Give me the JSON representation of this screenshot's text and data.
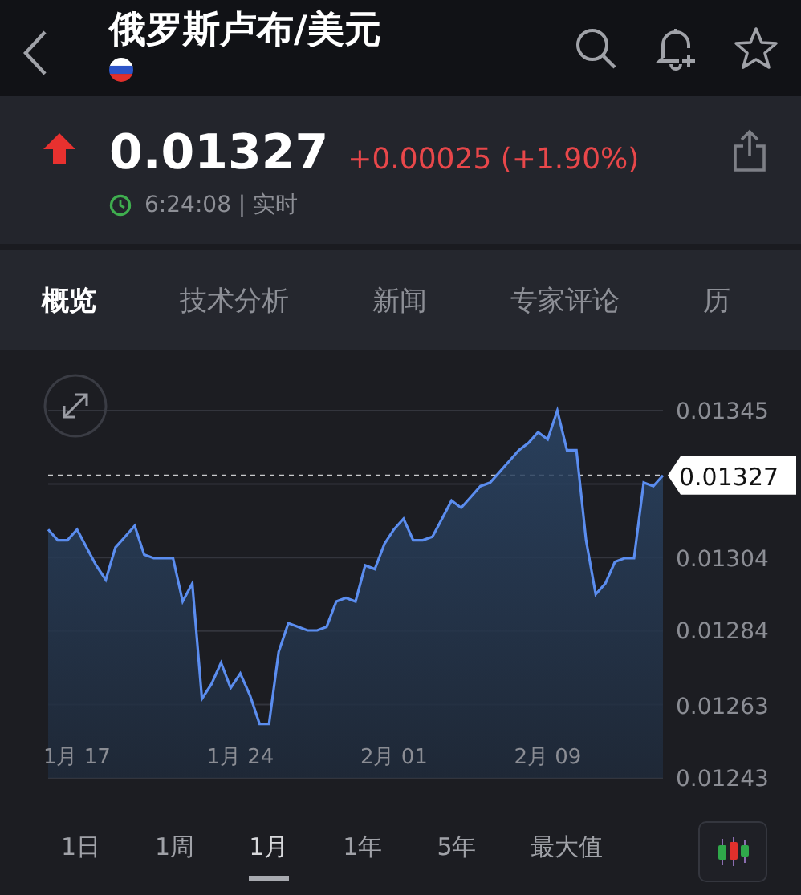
{
  "header": {
    "title": "俄罗斯卢布/美元"
  },
  "quote": {
    "up": true,
    "price": "0.01327",
    "change": "+0.00025 (+1.90%)",
    "time": "6:24:08 | 实时"
  },
  "tabs": [
    {
      "label": "概览",
      "selected": true
    },
    {
      "label": "技术分析",
      "selected": false
    },
    {
      "label": "新闻",
      "selected": false
    },
    {
      "label": "专家评论",
      "selected": false
    },
    {
      "label": "历",
      "selected": false
    }
  ],
  "chart": {
    "chart_data": {
      "type": "area",
      "grid": true,
      "categories": [
        null,
        null,
        null,
        "1月 17",
        null,
        null,
        null,
        null,
        null,
        null,
        null,
        null,
        null,
        null,
        null,
        null,
        null,
        null,
        null,
        null,
        "1月 24",
        null,
        null,
        null,
        null,
        null,
        null,
        null,
        null,
        null,
        null,
        null,
        null,
        null,
        null,
        null,
        "2月 01",
        null,
        null,
        null,
        null,
        null,
        null,
        null,
        null,
        null,
        null,
        null,
        null,
        null,
        null,
        null,
        "2月 09",
        null,
        null,
        null,
        null,
        null,
        null,
        null,
        null,
        null,
        null,
        null,
        null
      ],
      "series": [
        {
          "color": "#5b8def",
          "values": [
            0.01312,
            0.01309,
            0.01309,
            0.01312,
            0.01307,
            0.01302,
            0.01298,
            0.01307,
            0.0131,
            0.01313,
            0.01305,
            0.01304,
            0.01304,
            0.01304,
            0.01292,
            0.01297,
            0.01265,
            0.01269,
            0.01275,
            0.01268,
            0.01272,
            0.01266,
            0.01258,
            0.01258,
            0.01278,
            0.01286,
            0.01285,
            0.01284,
            0.01284,
            0.01285,
            0.01292,
            0.01293,
            0.01292,
            0.01302,
            0.01301,
            0.01308,
            0.01312,
            0.01315,
            0.01309,
            0.01309,
            0.0131,
            0.01315,
            0.0132,
            0.01318,
            0.01321,
            0.01324,
            0.01325,
            0.01328,
            0.01331,
            0.01334,
            0.01336,
            0.01339,
            0.01337,
            0.01345,
            0.01334,
            0.01334,
            0.01309,
            0.01294,
            0.01297,
            0.01303,
            0.01304,
            0.01304,
            0.01325,
            0.01324,
            0.01327
          ]
        }
      ],
      "ylim": [
        0.01243,
        0.01345
      ],
      "yticks": [
        {
          "value": 0.01345,
          "label": "0.01345"
        },
        {
          "value": 0.01304,
          "label": "0.01304"
        },
        {
          "value": 0.01284,
          "label": "0.01284"
        },
        {
          "value": 0.01263,
          "label": "0.01263"
        },
        {
          "value": 0.01243,
          "label": "0.01243"
        }
      ],
      "ref_lines": [
        {
          "axis": "y",
          "value": 0.01327,
          "label": "0.01327"
        }
      ]
    }
  },
  "ranges": [
    {
      "label": "1日",
      "selected": false
    },
    {
      "label": "1周",
      "selected": false
    },
    {
      "label": "1月",
      "selected": true
    },
    {
      "label": "1年",
      "selected": false
    },
    {
      "label": "5年",
      "selected": false
    },
    {
      "label": "最大值",
      "selected": false
    }
  ]
}
